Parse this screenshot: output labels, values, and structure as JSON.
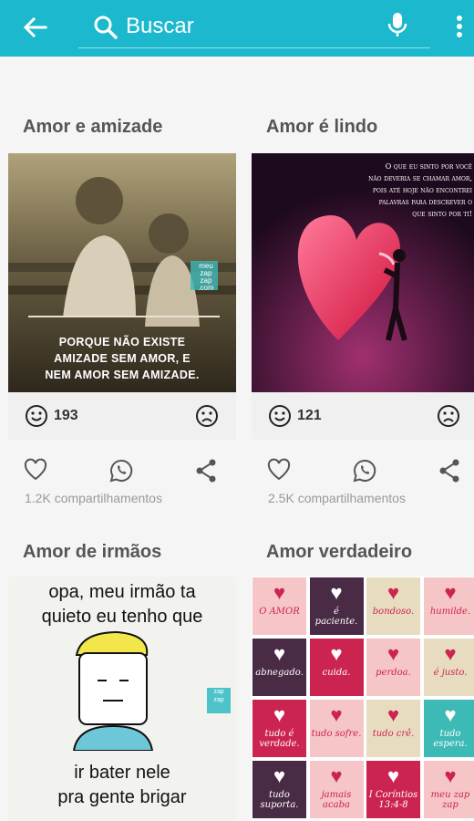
{
  "search": {
    "placeholder": "Buscar"
  },
  "icons": [
    "back-arrow-icon",
    "search-icon",
    "microphone-icon",
    "more-vert-icon",
    "happy-face-icon",
    "sad-face-icon",
    "heart-icon",
    "whatsapp-icon",
    "share-icon"
  ],
  "cards": [
    {
      "title": "Amor e amizade",
      "quote": [
        "PORQUE NÃO EXISTE",
        "AMIZADE SEM AMOR, E",
        "NEM AMOR SEM AMIZADE."
      ],
      "watermark": [
        "meu",
        "zap",
        "zap",
        ".com"
      ],
      "reactions": "193",
      "shares": "1.2K compartilhamentos"
    },
    {
      "title": "Amor é lindo",
      "quote": [
        "O que eu sinto por você",
        "não deveria se chamar amor,",
        "pois até hoje não encontrei",
        "palavras para descrever o",
        "que sinto por ti!"
      ],
      "reactions": "121",
      "shares": "2.5K compartilhamentos"
    },
    {
      "title": "Amor de irmãos",
      "top_text": [
        "opa, meu irmão ta",
        "quieto eu tenho que"
      ],
      "bottom_text": [
        "ir bater nele",
        "pra gente brigar"
      ],
      "watermark": [
        "zap",
        "zap"
      ]
    },
    {
      "title": "Amor verdadeiro",
      "tiles": [
        "O AMOR",
        "é paciente.",
        "bondoso.",
        "humilde.",
        "abnegado.",
        "cuida.",
        "perdoa.",
        "é justo.",
        "tudo é verdade.",
        "tudo sofre.",
        "tudo crê.",
        "tudo espera.",
        "tudo suporta.",
        "jamais acaba",
        "I Coríntios 13:4-8",
        "meu zap zap"
      ]
    }
  ],
  "colors": {
    "topbar": "#1cb8cd",
    "tiles": [
      "#f6c5c8",
      "#4a2b45",
      "#e8dcc0",
      "#f6c5c8",
      "#4a2b45",
      "#cc2450",
      "#f6c5c8",
      "#e8dcc0",
      "#cc2450",
      "#f6c5c8",
      "#e8dcc0",
      "#3dbab6",
      "#4a2b45",
      "#f6c5c8",
      "#cc2450",
      "#f6c5c8"
    ]
  }
}
